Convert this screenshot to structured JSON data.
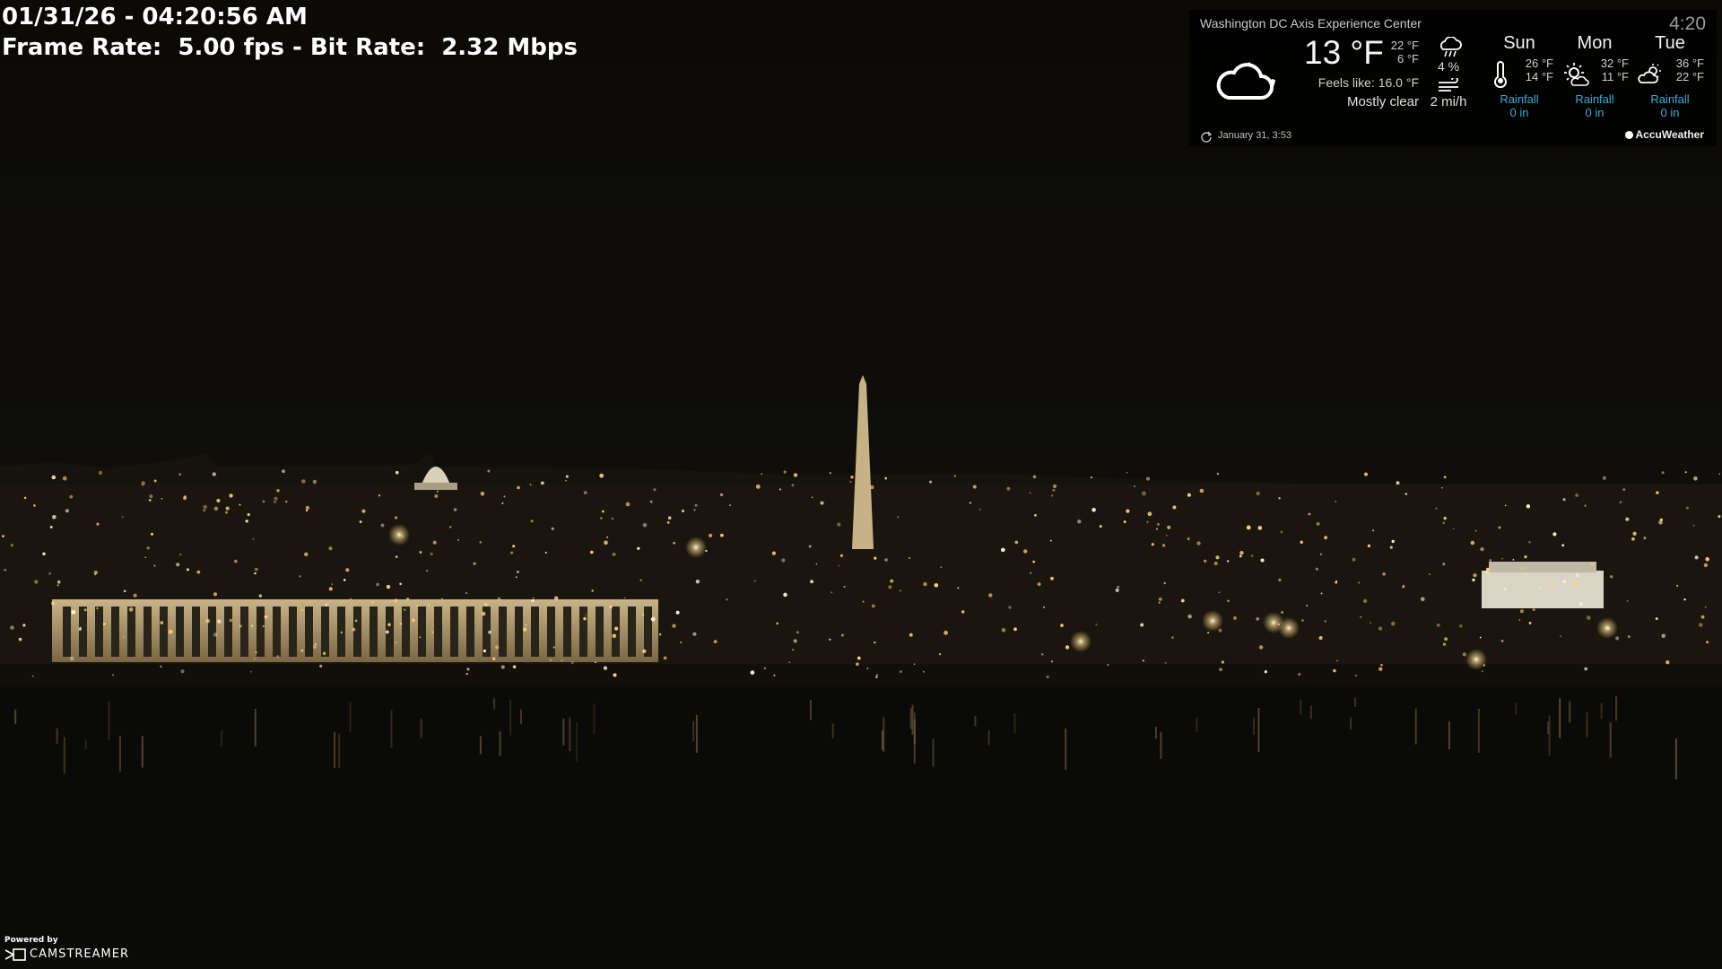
{
  "stream": {
    "datetime": "01/31/26 - 04:20:56 AM",
    "rates": "Frame Rate:  5.00 fps - Bit Rate:  2.32 Mbps"
  },
  "weather": {
    "location": "Washington DC Axis Experience Center",
    "time": "4:20",
    "current_icon": "partly-cloudy-night-icon",
    "temperature": "13 °F",
    "high": "22 °F",
    "low": "6 °F",
    "feels_like": "Feels like: 16.0 °F",
    "condition": "Mostly clear",
    "precip_icon": "rain-cloud-icon",
    "precipitation": "4 %",
    "wind_icon": "wind-icon",
    "wind": "2 mi/h",
    "updated": "January 31, 3:53",
    "provider": "AccuWeather",
    "forecast": [
      {
        "day": "Sun",
        "icon": "thermometer-icon",
        "high": "26 °F",
        "low": "14 °F",
        "rain_label": "Rainfall",
        "rain_value": "0 in"
      },
      {
        "day": "Mon",
        "icon": "sun-cloud-icon",
        "high": "32 °F",
        "low": "11 °F",
        "rain_label": "Rainfall",
        "rain_value": "0 in"
      },
      {
        "day": "Tue",
        "icon": "cloud-sun-icon",
        "high": "36 °F",
        "low": "22 °F",
        "rain_label": "Rainfall",
        "rain_value": "0 in"
      }
    ],
    "accent_color": "#3fa9d9"
  },
  "powered": {
    "label": "Powered by",
    "brand": "CAMSTREAMER"
  }
}
